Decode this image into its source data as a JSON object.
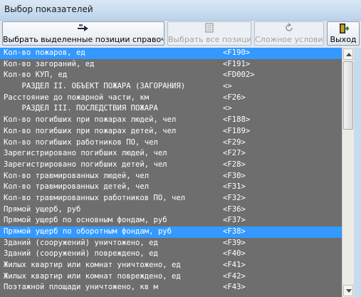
{
  "window": {
    "title": "Выбор показателей"
  },
  "toolbar": {
    "select_label": "Выбрать выделенные позиции справочника",
    "select_all_label": "Выбрать все позиции",
    "complex_condition_label": "Сложное условие",
    "exit_label": "Выход"
  },
  "list": {
    "selected_rows": [
      0,
      16
    ],
    "rows": [
      {
        "name": "Кол-во пожаров, ед",
        "code": "<F190>"
      },
      {
        "name": "Кол-во загораний, ед",
        "code": "<F191>"
      },
      {
        "name": "Кол-во КУП, ед",
        "code": "<FD002>"
      },
      {
        "name": "    РАЗДЕЛ II. ОБЪЕКТ ПОЖАРА (ЗАГОРАНИЯ)",
        "code": "<>"
      },
      {
        "name": "Расстояние до пожарной части, км",
        "code": "<F26>"
      },
      {
        "name": "    РАЗДЕЛ III. ПОСЛЕДСТВИЯ ПОЖАРА",
        "code": "<>"
      },
      {
        "name": "Кол-во погибших при пожарах людей, чел",
        "code": "<F188>"
      },
      {
        "name": "Кол-во погибших при пожарах детей, чел",
        "code": "<F189>"
      },
      {
        "name": "Кол-во погибших работников ПО, чел",
        "code": "<F29>"
      },
      {
        "name": "Зарегистрировано погибших людей, чел",
        "code": "<F27>"
      },
      {
        "name": "Зарегистрировано погибших детей, чел",
        "code": "<F28>"
      },
      {
        "name": "Кол-во травмированных людей, чел",
        "code": "<F30>"
      },
      {
        "name": "Кол-во травмированных детей, чел",
        "code": "<F31>"
      },
      {
        "name": "Кол-во травмированных работников ПО, чел",
        "code": "<F32>"
      },
      {
        "name": "Прямой ущерб, руб",
        "code": "<F36>"
      },
      {
        "name": "Прямой ущерб по основным фондам, руб",
        "code": "<F37>"
      },
      {
        "name": "Прямой ущерб по оборотным фондам, руб",
        "code": "<F38>"
      },
      {
        "name": "Зданий (сооружений) уничтожено, ед",
        "code": "<F39>"
      },
      {
        "name": "Зданий (сооружений) повреждено, ед",
        "code": "<F40>"
      },
      {
        "name": "Жилых квартир или комнат уничтожено, ед",
        "code": "<F41>"
      },
      {
        "name": "Жилых квартир или комнат повреждено, ед",
        "code": "<F42>"
      },
      {
        "name": "Поэтажной площади уничтожено, кв м",
        "code": "<F43>"
      }
    ]
  },
  "colors": {
    "list_background": "#6e6e6e",
    "selection": "#3399ff",
    "list_text": "#ffffff"
  },
  "icons": [
    "select-hand-icon",
    "select-all-icon",
    "refresh-icon",
    "exit-door-icon"
  ]
}
